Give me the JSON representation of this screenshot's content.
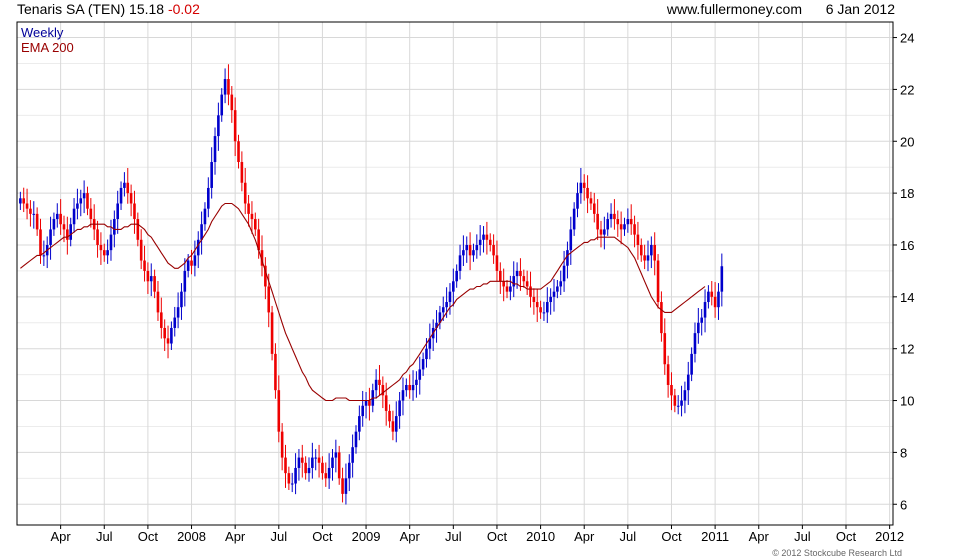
{
  "header": {
    "symbol": "Tenaris SA (TEN)",
    "price": "15.18",
    "change": "-0.02",
    "site": "www.fullermoney.com",
    "date": "6 Jan 2012"
  },
  "legend": {
    "period": "Weekly",
    "ema": "EMA 200"
  },
  "copyright": "© 2012 Stockcube Research Ltd",
  "colors": {
    "up": "#0000cc",
    "down": "#ee0000",
    "ema": "#990000",
    "grid": "#d8d8d8",
    "axis": "#000000"
  },
  "chart_data": {
    "type": "candlestick",
    "y_ticks": [
      6,
      8,
      10,
      12,
      14,
      16,
      18,
      20,
      22,
      24
    ],
    "ylim": [
      5.2,
      24.6
    ],
    "x_tick_labels": [
      "Apr",
      "Jul",
      "Oct",
      "2008",
      "Apr",
      "Jul",
      "Oct",
      "2009",
      "Apr",
      "Jul",
      "Oct",
      "2010",
      "Apr",
      "Jul",
      "Oct",
      "2011",
      "Apr",
      "Jul",
      "Oct",
      "2012"
    ],
    "x_tick_weeks": [
      13,
      26,
      39,
      52,
      65,
      78,
      91,
      104,
      117,
      130,
      143,
      156,
      169,
      182,
      195,
      208,
      221,
      234,
      247,
      260
    ],
    "weeks_range": [
      0,
      261
    ],
    "close": [
      17.8,
      17.6,
      17.4,
      17.2,
      17.2,
      16.6,
      15.6,
      15.6,
      16.0,
      16.6,
      17.0,
      17.2,
      16.8,
      16.6,
      16.2,
      16.8,
      17.4,
      17.6,
      17.8,
      18.0,
      17.4,
      17.0,
      16.6,
      16.0,
      15.8,
      15.6,
      15.8,
      16.4,
      17.0,
      17.6,
      18.2,
      18.4,
      18.0,
      17.6,
      17.0,
      16.2,
      15.4,
      15.0,
      14.6,
      14.8,
      14.2,
      13.4,
      12.8,
      12.4,
      12.2,
      12.8,
      13.2,
      13.6,
      14.2,
      15.0,
      15.4,
      15.2,
      15.6,
      16.2,
      16.8,
      17.4,
      18.2,
      19.2,
      20.2,
      21.0,
      21.8,
      22.4,
      21.8,
      21.2,
      20.0,
      19.2,
      18.4,
      17.6,
      17.2,
      17.0,
      16.6,
      15.8,
      15.2,
      14.4,
      13.4,
      11.8,
      10.4,
      8.8,
      7.8,
      7.2,
      6.8,
      6.8,
      7.4,
      7.8,
      7.6,
      7.2,
      7.4,
      7.8,
      7.8,
      7.6,
      7.2,
      7.0,
      7.4,
      7.8,
      8.0,
      7.0,
      6.4,
      7.0,
      7.6,
      8.2,
      8.8,
      9.4,
      9.8,
      10.0,
      9.8,
      10.4,
      10.8,
      10.6,
      10.2,
      9.6,
      9.2,
      8.8,
      9.4,
      10.0,
      10.4,
      10.6,
      10.4,
      10.6,
      10.8,
      11.2,
      11.6,
      12.0,
      12.4,
      12.8,
      13.0,
      13.4,
      13.6,
      13.8,
      14.2,
      14.6,
      15.0,
      15.6,
      15.8,
      16.0,
      15.6,
      15.8,
      16.0,
      16.2,
      16.4,
      16.2,
      16.0,
      15.6,
      15.0,
      14.6,
      14.4,
      14.2,
      14.4,
      14.8,
      15.0,
      14.8,
      14.6,
      14.4,
      14.0,
      13.8,
      13.6,
      13.4,
      13.4,
      13.8,
      14.0,
      14.2,
      14.4,
      14.6,
      15.2,
      15.8,
      16.6,
      17.4,
      18.0,
      18.4,
      18.2,
      17.8,
      17.6,
      17.2,
      16.6,
      16.4,
      16.6,
      17.0,
      17.2,
      17.0,
      16.8,
      16.6,
      16.8,
      17.0,
      16.8,
      16.4,
      16.0,
      15.6,
      15.4,
      15.6,
      16.0,
      15.4,
      13.8,
      12.6,
      11.4,
      10.6,
      10.2,
      9.8,
      9.8,
      10.0,
      10.4,
      11.0,
      11.8,
      12.6,
      13.0,
      13.2,
      13.8,
      14.2,
      14.0,
      13.6,
      14.2,
      15.18
    ],
    "open": [
      17.6,
      17.8,
      17.6,
      17.4,
      17.2,
      17.2,
      16.6,
      15.6,
      15.6,
      16.0,
      16.6,
      17.0,
      17.2,
      16.8,
      16.6,
      16.2,
      16.8,
      17.4,
      17.6,
      17.8,
      18.0,
      17.4,
      17.0,
      16.6,
      16.0,
      15.8,
      15.6,
      15.8,
      16.4,
      17.0,
      17.6,
      18.2,
      18.4,
      18.0,
      17.6,
      17.0,
      16.2,
      15.4,
      15.0,
      14.6,
      14.8,
      14.2,
      13.4,
      12.8,
      12.4,
      12.2,
      12.8,
      13.2,
      13.6,
      14.2,
      15.0,
      15.4,
      15.2,
      15.6,
      16.2,
      16.8,
      17.4,
      18.2,
      19.2,
      20.2,
      21.0,
      21.8,
      22.4,
      21.8,
      21.2,
      20.0,
      19.2,
      18.4,
      17.6,
      17.2,
      17.0,
      16.6,
      15.8,
      15.2,
      14.4,
      13.4,
      11.8,
      10.4,
      8.8,
      7.8,
      7.2,
      6.8,
      6.8,
      7.4,
      7.8,
      7.6,
      7.2,
      7.4,
      7.8,
      7.8,
      7.6,
      7.2,
      7.0,
      7.4,
      7.8,
      8.0,
      7.0,
      6.4,
      7.0,
      7.6,
      8.2,
      8.8,
      9.4,
      9.8,
      10.0,
      9.8,
      10.4,
      10.8,
      10.6,
      10.2,
      9.6,
      9.2,
      8.8,
      9.4,
      10.0,
      10.4,
      10.6,
      10.4,
      10.6,
      10.8,
      11.2,
      11.6,
      12.0,
      12.4,
      12.8,
      13.0,
      13.4,
      13.6,
      13.8,
      14.2,
      14.6,
      15.0,
      15.6,
      15.8,
      16.0,
      15.6,
      15.8,
      16.0,
      16.2,
      16.4,
      16.2,
      16.0,
      15.6,
      15.0,
      14.6,
      14.4,
      14.2,
      14.4,
      14.8,
      15.0,
      14.8,
      14.6,
      14.4,
      14.0,
      13.8,
      13.6,
      13.4,
      13.4,
      13.8,
      14.0,
      14.2,
      14.4,
      14.6,
      15.2,
      15.8,
      16.6,
      17.4,
      18.0,
      18.4,
      18.2,
      17.8,
      17.6,
      17.2,
      16.6,
      16.4,
      16.6,
      17.0,
      17.2,
      17.0,
      16.8,
      16.6,
      16.8,
      17.0,
      16.8,
      16.4,
      16.0,
      15.6,
      15.4,
      15.6,
      16.0,
      15.4,
      13.8,
      12.6,
      11.4,
      10.6,
      10.2,
      9.8,
      9.8,
      10.0,
      10.4,
      11.0,
      11.8,
      12.6,
      13.0,
      13.2,
      13.8,
      14.2,
      14.0,
      13.6,
      14.2
    ],
    "ema200": [
      15.1,
      15.2,
      15.3,
      15.4,
      15.5,
      15.6,
      15.6,
      15.7,
      15.8,
      15.9,
      16.0,
      16.1,
      16.2,
      16.3,
      16.3,
      16.4,
      16.5,
      16.6,
      16.6,
      16.7,
      16.7,
      16.8,
      16.8,
      16.8,
      16.8,
      16.8,
      16.7,
      16.7,
      16.6,
      16.6,
      16.6,
      16.7,
      16.7,
      16.8,
      16.8,
      16.8,
      16.7,
      16.6,
      16.4,
      16.3,
      16.1,
      15.9,
      15.7,
      15.5,
      15.3,
      15.2,
      15.1,
      15.1,
      15.2,
      15.3,
      15.5,
      15.6,
      15.8,
      16.0,
      16.2,
      16.4,
      16.6,
      16.9,
      17.1,
      17.3,
      17.5,
      17.6,
      17.6,
      17.6,
      17.5,
      17.4,
      17.2,
      17.0,
      16.8,
      16.5,
      16.2,
      15.8,
      15.4,
      15.0,
      14.6,
      14.2,
      13.8,
      13.4,
      13.0,
      12.6,
      12.3,
      12.0,
      11.7,
      11.4,
      11.1,
      10.9,
      10.6,
      10.4,
      10.3,
      10.2,
      10.1,
      10.0,
      10.0,
      10.0,
      10.1,
      10.1,
      10.1,
      10.1,
      10.0,
      10.0,
      10.0,
      10.0,
      10.0,
      10.0,
      10.0,
      10.1,
      10.1,
      10.2,
      10.3,
      10.4,
      10.5,
      10.6,
      10.7,
      10.8,
      11.0,
      11.1,
      11.3,
      11.4,
      11.6,
      11.8,
      12.0,
      12.2,
      12.4,
      12.6,
      12.8,
      13.0,
      13.2,
      13.4,
      13.6,
      13.7,
      13.9,
      14.0,
      14.1,
      14.2,
      14.3,
      14.3,
      14.4,
      14.4,
      14.5,
      14.5,
      14.6,
      14.6,
      14.6,
      14.6,
      14.6,
      14.6,
      14.6,
      14.5,
      14.5,
      14.4,
      14.4,
      14.3,
      14.3,
      14.3,
      14.3,
      14.3,
      14.4,
      14.5,
      14.6,
      14.8,
      15.0,
      15.2,
      15.4,
      15.6,
      15.7,
      15.8,
      15.9,
      16.0,
      16.1,
      16.1,
      16.2,
      16.2,
      16.3,
      16.3,
      16.3,
      16.3,
      16.3,
      16.3,
      16.2,
      16.1,
      16.0,
      15.9,
      15.7,
      15.5,
      15.2,
      14.9,
      14.6,
      14.3,
      14.0,
      13.8,
      13.6,
      13.5,
      13.4,
      13.4,
      13.4,
      13.5,
      13.6,
      13.7,
      13.8,
      13.9,
      14.0,
      14.1,
      14.2,
      14.3,
      14.4
    ]
  }
}
